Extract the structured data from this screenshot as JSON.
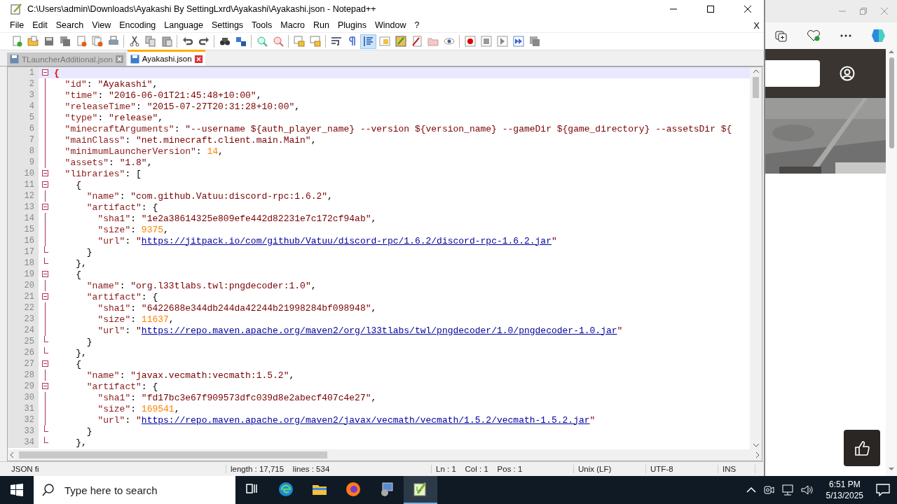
{
  "window": {
    "title": "C:\\Users\\admin\\Downloads\\Ayakashi By SettingLxrd\\Ayakashi\\Ayakashi.json - Notepad++"
  },
  "menu": [
    "File",
    "Edit",
    "Search",
    "View",
    "Encoding",
    "Language",
    "Settings",
    "Tools",
    "Macro",
    "Run",
    "Plugins",
    "Window",
    "?"
  ],
  "menu_close": "X",
  "toolbar": [
    {
      "buttons": [
        {
          "kind": "new",
          "on": false
        },
        {
          "kind": "open",
          "on": false
        },
        {
          "kind": "save",
          "on": false
        },
        {
          "kind": "save-all",
          "on": false
        },
        {
          "kind": "close",
          "on": false
        },
        {
          "kind": "close-all",
          "on": false
        },
        {
          "kind": "print",
          "on": false
        }
      ]
    },
    {
      "buttons": [
        {
          "kind": "cut",
          "on": false
        },
        {
          "kind": "copy",
          "on": false
        },
        {
          "kind": "paste",
          "on": false
        }
      ]
    },
    {
      "buttons": [
        {
          "kind": "undo",
          "on": false
        },
        {
          "kind": "redo",
          "on": false
        }
      ]
    },
    {
      "buttons": [
        {
          "kind": "find",
          "on": false
        },
        {
          "kind": "replace",
          "on": false
        }
      ]
    },
    {
      "buttons": [
        {
          "kind": "zoom-in",
          "on": false
        },
        {
          "kind": "zoom-out",
          "on": false
        }
      ]
    },
    {
      "buttons": [
        {
          "kind": "sync-v",
          "on": false
        },
        {
          "kind": "sync-h",
          "on": false
        }
      ]
    },
    {
      "buttons": [
        {
          "kind": "wrap",
          "on": false
        },
        {
          "kind": "pilcrow",
          "on": false
        },
        {
          "kind": "indent",
          "on": true
        },
        {
          "kind": "map",
          "on": false
        },
        {
          "kind": "notes",
          "on": false
        },
        {
          "kind": "pdf",
          "on": false
        },
        {
          "kind": "folder",
          "on": false
        },
        {
          "kind": "eye",
          "on": false
        }
      ]
    },
    {
      "buttons": [
        {
          "kind": "record",
          "on": false
        },
        {
          "kind": "stop",
          "on": false
        },
        {
          "kind": "play",
          "on": false
        },
        {
          "kind": "play-many",
          "on": false
        },
        {
          "kind": "save-macro",
          "on": false
        }
      ]
    }
  ],
  "tabs": [
    {
      "label": "TLauncherAdditional.json",
      "selected": false
    },
    {
      "label": "Ayakashi.json",
      "selected": true
    }
  ],
  "lines": [
    {
      "no": "1",
      "kind": "box",
      "current": true,
      "tokens": [
        {
          "kind": "brace",
          "text": "{"
        }
      ]
    },
    {
      "no": "2",
      "kind": "line",
      "current": false,
      "tokens": [
        {
          "kind": "key",
          "text": "  \"id\""
        },
        {
          "kind": "op",
          "text": ": "
        },
        {
          "kind": "str",
          "text": "\"Ayakashi\""
        },
        {
          "kind": "op",
          "text": ","
        }
      ]
    },
    {
      "no": "3",
      "kind": "line",
      "current": false,
      "tokens": [
        {
          "kind": "key",
          "text": "  \"time\""
        },
        {
          "kind": "op",
          "text": ": "
        },
        {
          "kind": "str",
          "text": "\"2016-06-01T21:45:48+10:00\""
        },
        {
          "kind": "op",
          "text": ","
        }
      ]
    },
    {
      "no": "4",
      "kind": "line",
      "current": false,
      "tokens": [
        {
          "kind": "key",
          "text": "  \"releaseTime\""
        },
        {
          "kind": "op",
          "text": ": "
        },
        {
          "kind": "str",
          "text": "\"2015-07-27T20:31:28+10:00\""
        },
        {
          "kind": "op",
          "text": ","
        }
      ]
    },
    {
      "no": "5",
      "kind": "line",
      "current": false,
      "tokens": [
        {
          "kind": "key",
          "text": "  \"type\""
        },
        {
          "kind": "op",
          "text": ": "
        },
        {
          "kind": "str",
          "text": "\"release\""
        },
        {
          "kind": "op",
          "text": ","
        }
      ]
    },
    {
      "no": "6",
      "kind": "line",
      "current": false,
      "tokens": [
        {
          "kind": "key",
          "text": "  \"minecraftArguments\""
        },
        {
          "kind": "op",
          "text": ": "
        },
        {
          "kind": "str",
          "text": "\"--username ${auth_player_name} --version ${version_name} --gameDir ${game_directory} --assetsDir ${"
        }
      ]
    },
    {
      "no": "7",
      "kind": "line",
      "current": false,
      "tokens": [
        {
          "kind": "key",
          "text": "  \"mainClass\""
        },
        {
          "kind": "op",
          "text": ": "
        },
        {
          "kind": "str",
          "text": "\"net.minecraft.client.main.Main\""
        },
        {
          "kind": "op",
          "text": ","
        }
      ]
    },
    {
      "no": "8",
      "kind": "line",
      "current": false,
      "tokens": [
        {
          "kind": "key",
          "text": "  \"minimumLauncherVersion\""
        },
        {
          "kind": "op",
          "text": ": "
        },
        {
          "kind": "num",
          "text": "14"
        },
        {
          "kind": "op",
          "text": ","
        }
      ]
    },
    {
      "no": "9",
      "kind": "line",
      "current": false,
      "tokens": [
        {
          "kind": "key",
          "text": "  \"assets\""
        },
        {
          "kind": "op",
          "text": ": "
        },
        {
          "kind": "str",
          "text": "\"1.8\""
        },
        {
          "kind": "op",
          "text": ","
        }
      ]
    },
    {
      "no": "10",
      "kind": "box",
      "current": false,
      "tokens": [
        {
          "kind": "key",
          "text": "  \"libraries\""
        },
        {
          "kind": "op",
          "text": ": ["
        }
      ]
    },
    {
      "no": "11",
      "kind": "box",
      "current": false,
      "tokens": [
        {
          "kind": "op",
          "text": "    {"
        }
      ]
    },
    {
      "no": "12",
      "kind": "line",
      "current": false,
      "tokens": [
        {
          "kind": "key",
          "text": "      \"name\""
        },
        {
          "kind": "op",
          "text": ": "
        },
        {
          "kind": "str",
          "text": "\"com.github.Vatuu:discord-rpc:1.6.2\""
        },
        {
          "kind": "op",
          "text": ","
        }
      ]
    },
    {
      "no": "13",
      "kind": "box",
      "current": false,
      "tokens": [
        {
          "kind": "key",
          "text": "      \"artifact\""
        },
        {
          "kind": "op",
          "text": ": {"
        }
      ]
    },
    {
      "no": "14",
      "kind": "line",
      "current": false,
      "tokens": [
        {
          "kind": "key",
          "text": "        \"sha1\""
        },
        {
          "kind": "op",
          "text": ": "
        },
        {
          "kind": "str",
          "text": "\"1e2a38614325e809efe442d82231e7c172cf94ab\""
        },
        {
          "kind": "op",
          "text": ","
        }
      ]
    },
    {
      "no": "15",
      "kind": "line",
      "current": false,
      "tokens": [
        {
          "kind": "key",
          "text": "        \"size\""
        },
        {
          "kind": "op",
          "text": ": "
        },
        {
          "kind": "num",
          "text": "9375"
        },
        {
          "kind": "op",
          "text": ","
        }
      ]
    },
    {
      "no": "16",
      "kind": "line",
      "current": false,
      "tokens": [
        {
          "kind": "key",
          "text": "        \"url\""
        },
        {
          "kind": "op",
          "text": ": "
        },
        {
          "kind": "str",
          "text": "\""
        },
        {
          "kind": "url",
          "text": "https://jitpack.io/com/github/Vatuu/discord-rpc/1.6.2/discord-rpc-1.6.2.jar"
        },
        {
          "kind": "str",
          "text": "\""
        }
      ]
    },
    {
      "no": "17",
      "kind": "end",
      "current": false,
      "tokens": [
        {
          "kind": "op",
          "text": "      }"
        }
      ]
    },
    {
      "no": "18",
      "kind": "end",
      "current": false,
      "tokens": [
        {
          "kind": "op",
          "text": "    },"
        }
      ]
    },
    {
      "no": "19",
      "kind": "box",
      "current": false,
      "tokens": [
        {
          "kind": "op",
          "text": "    {"
        }
      ]
    },
    {
      "no": "20",
      "kind": "line",
      "current": false,
      "tokens": [
        {
          "kind": "key",
          "text": "      \"name\""
        },
        {
          "kind": "op",
          "text": ": "
        },
        {
          "kind": "str",
          "text": "\"org.l33tlabs.twl:pngdecoder:1.0\""
        },
        {
          "kind": "op",
          "text": ","
        }
      ]
    },
    {
      "no": "21",
      "kind": "box",
      "current": false,
      "tokens": [
        {
          "kind": "key",
          "text": "      \"artifact\""
        },
        {
          "kind": "op",
          "text": ": {"
        }
      ]
    },
    {
      "no": "22",
      "kind": "line",
      "current": false,
      "tokens": [
        {
          "kind": "key",
          "text": "        \"sha1\""
        },
        {
          "kind": "op",
          "text": ": "
        },
        {
          "kind": "str",
          "text": "\"6422688e344db244da42244b21998284bf098948\""
        },
        {
          "kind": "op",
          "text": ","
        }
      ]
    },
    {
      "no": "23",
      "kind": "line",
      "current": false,
      "tokens": [
        {
          "kind": "key",
          "text": "        \"size\""
        },
        {
          "kind": "op",
          "text": ": "
        },
        {
          "kind": "num",
          "text": "11637"
        },
        {
          "kind": "op",
          "text": ","
        }
      ]
    },
    {
      "no": "24",
      "kind": "line",
      "current": false,
      "tokens": [
        {
          "kind": "key",
          "text": "        \"url\""
        },
        {
          "kind": "op",
          "text": ": "
        },
        {
          "kind": "str",
          "text": "\""
        },
        {
          "kind": "url",
          "text": "https://repo.maven.apache.org/maven2/org/l33tlabs/twl/pngdecoder/1.0/pngdecoder-1.0.jar"
        },
        {
          "kind": "str",
          "text": "\""
        }
      ]
    },
    {
      "no": "25",
      "kind": "end",
      "current": false,
      "tokens": [
        {
          "kind": "op",
          "text": "      }"
        }
      ]
    },
    {
      "no": "26",
      "kind": "end",
      "current": false,
      "tokens": [
        {
          "kind": "op",
          "text": "    },"
        }
      ]
    },
    {
      "no": "27",
      "kind": "box",
      "current": false,
      "tokens": [
        {
          "kind": "op",
          "text": "    {"
        }
      ]
    },
    {
      "no": "28",
      "kind": "line",
      "current": false,
      "tokens": [
        {
          "kind": "key",
          "text": "      \"name\""
        },
        {
          "kind": "op",
          "text": ": "
        },
        {
          "kind": "str",
          "text": "\"javax.vecmath:vecmath:1.5.2\""
        },
        {
          "kind": "op",
          "text": ","
        }
      ]
    },
    {
      "no": "29",
      "kind": "box",
      "current": false,
      "tokens": [
        {
          "kind": "key",
          "text": "      \"artifact\""
        },
        {
          "kind": "op",
          "text": ": {"
        }
      ]
    },
    {
      "no": "30",
      "kind": "line",
      "current": false,
      "tokens": [
        {
          "kind": "key",
          "text": "        \"sha1\""
        },
        {
          "kind": "op",
          "text": ": "
        },
        {
          "kind": "str",
          "text": "\"fd17bc3e67f909573dfc039d8e2abecf407c4e27\""
        },
        {
          "kind": "op",
          "text": ","
        }
      ]
    },
    {
      "no": "31",
      "kind": "line",
      "current": false,
      "tokens": [
        {
          "kind": "key",
          "text": "        \"size\""
        },
        {
          "kind": "op",
          "text": ": "
        },
        {
          "kind": "num",
          "text": "169541"
        },
        {
          "kind": "op",
          "text": ","
        }
      ]
    },
    {
      "no": "32",
      "kind": "line",
      "current": false,
      "tokens": [
        {
          "kind": "key",
          "text": "        \"url\""
        },
        {
          "kind": "op",
          "text": ": "
        },
        {
          "kind": "str",
          "text": "\""
        },
        {
          "kind": "url",
          "text": "https://repo.maven.apache.org/maven2/javax/vecmath/vecmath/1.5.2/vecmath-1.5.2.jar"
        },
        {
          "kind": "str",
          "text": "\""
        }
      ]
    },
    {
      "no": "33",
      "kind": "end",
      "current": false,
      "tokens": [
        {
          "kind": "op",
          "text": "      }"
        }
      ]
    },
    {
      "no": "34",
      "kind": "end",
      "current": false,
      "tokens": [
        {
          "kind": "op",
          "text": "    },"
        }
      ]
    }
  ],
  "status_bar": [
    "JSON fi",
    "length : 17,715    lines : 534",
    "Ln : 1    Col : 1    Pos : 1",
    "Unix (LF)",
    "UTF-8",
    "INS"
  ],
  "taskbar": {
    "search": {
      "placeholder": "Type here to search"
    },
    "apps": [
      {
        "kind": "task-view",
        "active": false
      },
      {
        "kind": "edge",
        "active": false
      },
      {
        "kind": "explorer",
        "active": false
      },
      {
        "kind": "firefox",
        "active": false
      },
      {
        "kind": "installer",
        "active": false
      },
      {
        "kind": "notepad",
        "active": true
      }
    ],
    "time": "6:51 PM",
    "date": "5/13/2025"
  }
}
